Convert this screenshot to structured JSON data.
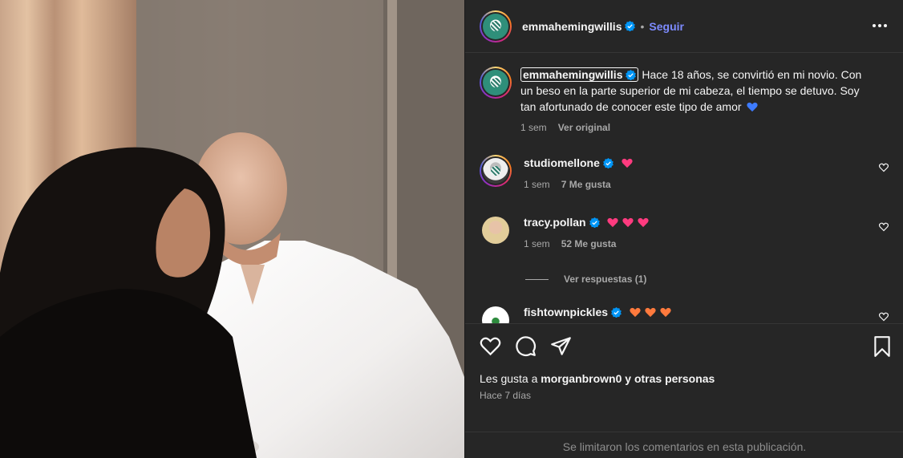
{
  "post": {
    "author": "emmahemingwillis",
    "follow_label": "Seguir",
    "dot": "•"
  },
  "caption": {
    "author": "emmahemingwillis",
    "text": "Hace 18 años, se convirtió en mi novio. Con un beso en la parte superior de mi cabeza, el tiempo se detuvo. Soy tan afortunado de conocer este tipo de amor",
    "time": "1 sem",
    "translate_label": "Ver original"
  },
  "comments": [
    {
      "user": "studiomellone",
      "time": "1 sem",
      "likes": "7 Me gusta"
    },
    {
      "user": "tracy.pollan",
      "time": "1 sem",
      "likes": "52 Me gusta",
      "replies_label": "Ver respuestas (1)"
    },
    {
      "user": "fishtownpickles"
    }
  ],
  "footer": {
    "likes_prefix": "Les gusta a ",
    "likes_user": "morganbrown0",
    "likes_suffix": " y otras personas",
    "posted": "Hace 7 días",
    "comments_limited": "Se limitaron los comentarios en esta publicación."
  },
  "colors": {
    "panel_bg": "#262626",
    "text": "#f5f5f5",
    "muted": "#a8a8a8",
    "link": "#7d8bff",
    "verified": "#0095f6",
    "heart_pink": "#ff3b7f",
    "heart_orange": "#ff7a3d",
    "heart_blue": "#3d7bff"
  },
  "icons": [
    "verified-icon",
    "more-icon",
    "like-icon",
    "comment-icon",
    "share-icon",
    "save-icon",
    "heart-emoji-icon"
  ]
}
